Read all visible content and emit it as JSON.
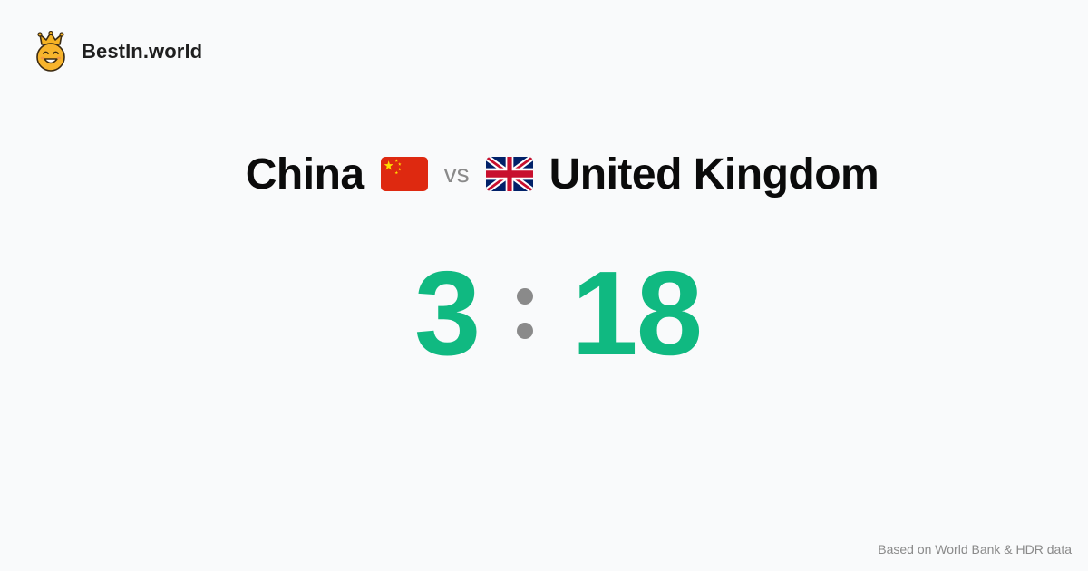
{
  "brand": {
    "name": "BestIn.world",
    "logo_icon": "crown-smiley-icon",
    "accent": "#f5b324"
  },
  "matchup": {
    "left_country": "China",
    "left_flag": "flag-china-icon",
    "separator": "vs",
    "right_country": "United Kingdom",
    "right_flag": "flag-united-kingdom-icon"
  },
  "score": {
    "left": "3",
    "right": "18",
    "color": "#10b981",
    "separator_color": "#8a8a8a"
  },
  "footer": {
    "source_text": "Based on World Bank & HDR data"
  },
  "colors": {
    "background": "#f9fafb",
    "text": "#0b0b0b",
    "muted": "#8a8a8a",
    "china_red": "#de2910",
    "china_yellow": "#ffde00",
    "uk_blue": "#012169",
    "uk_red": "#c8102e"
  }
}
